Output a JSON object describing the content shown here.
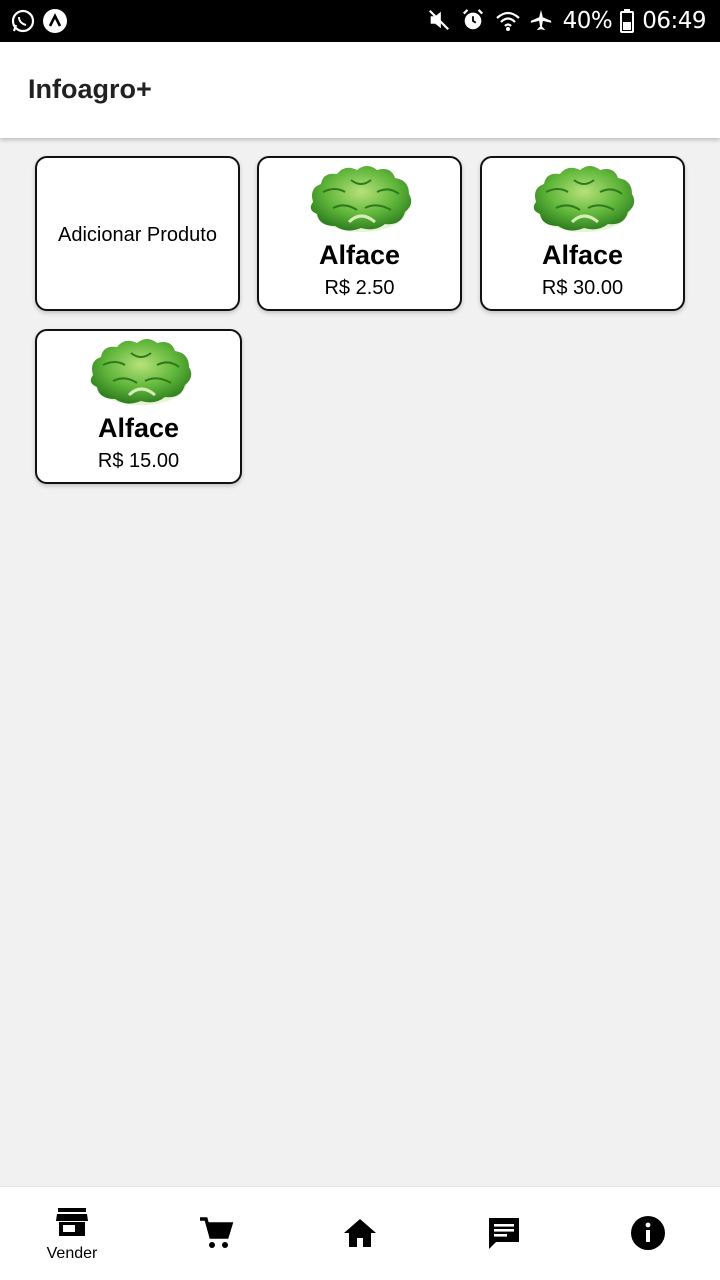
{
  "status_bar": {
    "battery": "40%",
    "time": "06:49",
    "icons": [
      "whatsapp-icon",
      "app-notification-icon",
      "mute-icon",
      "alarm-icon",
      "wifi-icon",
      "airplane-icon",
      "battery-icon"
    ]
  },
  "app_bar": {
    "title": "Infoagro+"
  },
  "grid": {
    "add_label": "Adicionar Produto",
    "products": [
      {
        "name": "Alface",
        "price": "R$ 2.50",
        "image": "lettuce"
      },
      {
        "name": "Alface",
        "price": "R$ 30.00",
        "image": "lettuce"
      },
      {
        "name": "Alface",
        "price": "R$ 15.00",
        "image": "lettuce"
      }
    ]
  },
  "bottom_nav": {
    "items": [
      {
        "icon": "store-icon",
        "label": "Vender"
      },
      {
        "icon": "cart-icon"
      },
      {
        "icon": "home-icon"
      },
      {
        "icon": "chat-icon"
      },
      {
        "icon": "info-icon"
      }
    ]
  },
  "colors": {
    "background": "#f1f1f1",
    "card_border": "#111111",
    "lettuce": "#4caf50"
  }
}
